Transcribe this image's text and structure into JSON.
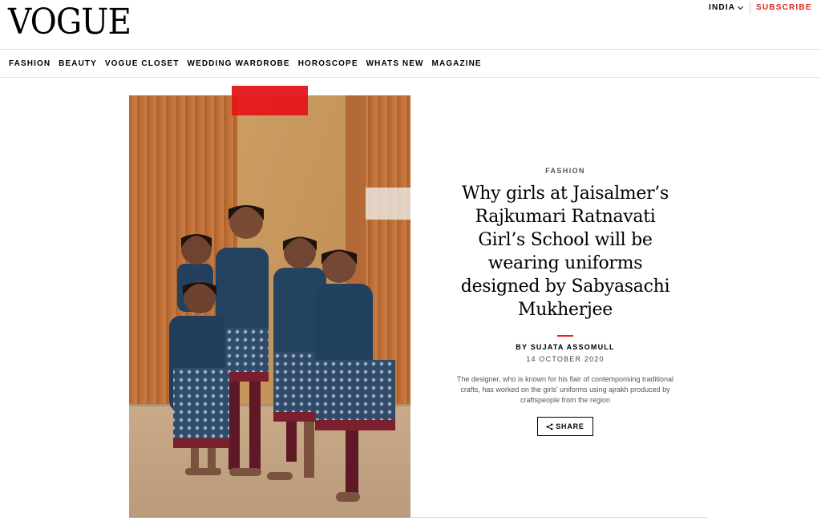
{
  "header": {
    "logo": "VOGUE",
    "region": "INDIA",
    "subscribe": "SUBSCRIBE"
  },
  "nav": {
    "items": [
      "FASHION",
      "BEAUTY",
      "VOGUE CLOSET",
      "WEDDING WARDROBE",
      "HOROSCOPE",
      "WHATS NEW",
      "MAGAZINE"
    ]
  },
  "hero": {
    "image_icon": "photo-girls-in-uniforms"
  },
  "article": {
    "category": "FASHION",
    "headline": "Why girls at Jaisalmer’s Rajkumari Ratnavati Girl’s School will be wearing uniforms designed by Sabyasachi Mukherjee",
    "byline": "BY SUJATA ASSOMULL",
    "date": "14 OCTOBER 2020",
    "summary": "The designer, who is known for his flair of contemporising traditional crafts, has worked on the girls' uniforms using ajrakh produced by craftspeople from the region",
    "share_label": "SHARE",
    "share_icon": "share-icon"
  },
  "colors": {
    "accent": "#e2231a",
    "text": "#000000"
  }
}
